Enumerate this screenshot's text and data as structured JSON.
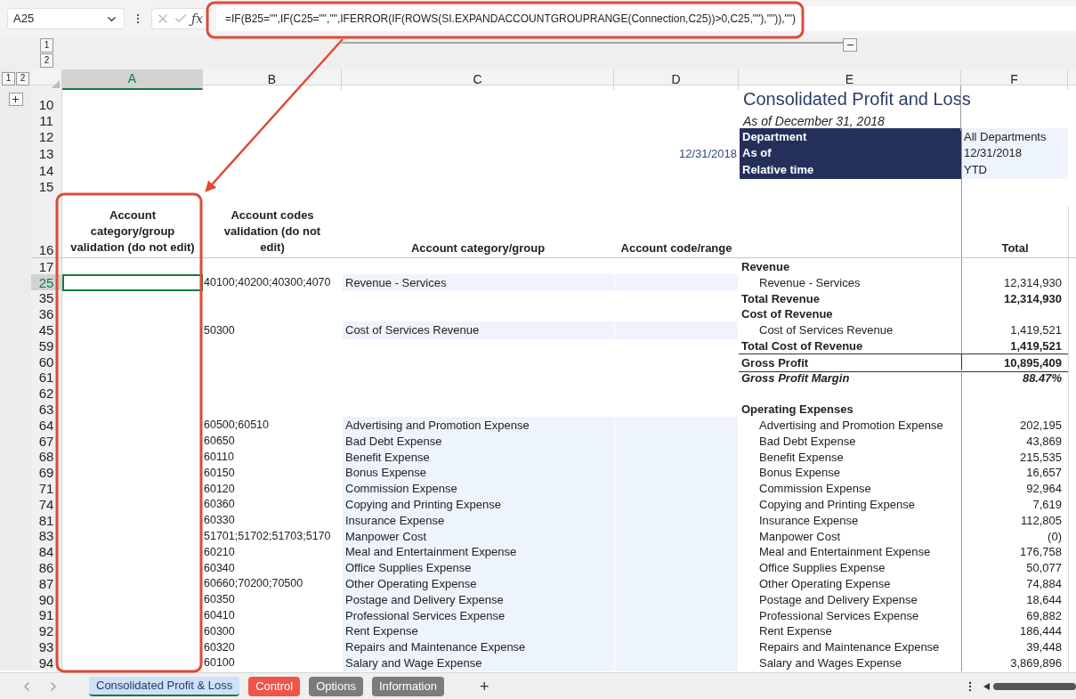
{
  "formula_bar": {
    "name_box": "A25",
    "function_label": "ƒx",
    "formula": "=IF(B25=\"\",IF(C25=\"\",\"\",IFERROR(IF(ROWS(SI.EXPANDACCOUNTGROUPRANGE(Connection,C25))>0,C25,\"\"),\"\")),\"\")"
  },
  "outline": {
    "column_levels": [
      "1",
      "2"
    ],
    "row_levels": [
      "1",
      "2"
    ]
  },
  "columns": [
    {
      "label": "A",
      "selected": true
    },
    {
      "label": "B",
      "selected": false
    },
    {
      "label": "C",
      "selected": false
    },
    {
      "label": "D",
      "selected": false
    },
    {
      "label": "E",
      "selected": false
    },
    {
      "label": "F",
      "selected": false
    }
  ],
  "report": {
    "row_numbers": [
      "10",
      "11",
      "12",
      "13",
      "14",
      "15",
      "16"
    ],
    "title": "Consolidated Profit and Loss",
    "subtitle": "As of December 31, 2018",
    "as_of_date": "12/31/2018",
    "parameters": [
      {
        "label": "Department",
        "value": "All Departments"
      },
      {
        "label": "As of",
        "value": "12/31/2018"
      },
      {
        "label": "Relative time",
        "value": "YTD"
      }
    ],
    "headers": {
      "a": "Account category/group validation (do not edit)",
      "b": "Account codes validation (do not edit)",
      "c": "Account category/group",
      "d": "Account code/range",
      "f": "Total"
    }
  },
  "rows": [
    {
      "row": "17",
      "kind": "heading",
      "label": "Revenue",
      "selected": false
    },
    {
      "row": "25",
      "kind": "item",
      "code": "40100;40200;40300;4070",
      "category": "Revenue - Services",
      "label": "Revenue - Services",
      "total": "12,314,930",
      "selected": true
    },
    {
      "row": "35",
      "kind": "total",
      "label": "Total Revenue",
      "total": "12,314,930",
      "selected": false
    },
    {
      "row": "36",
      "kind": "heading",
      "label": "Cost of Revenue",
      "selected": false
    },
    {
      "row": "45",
      "kind": "item",
      "code": "50300",
      "category": "Cost of Services Revenue",
      "label": "Cost of Services Revenue",
      "total": "1,419,521",
      "selected": false
    },
    {
      "row": "59",
      "kind": "total",
      "label": "Total Cost of Revenue",
      "total": "1,419,521",
      "selected": false
    },
    {
      "row": "60",
      "kind": "gross",
      "label": "Gross Profit",
      "total": "10,895,409",
      "selected": false
    },
    {
      "row": "61",
      "kind": "margin",
      "label": "Gross Profit Margin",
      "total": "88.47%",
      "selected": false
    },
    {
      "row": "62",
      "kind": "blank",
      "selected": false
    },
    {
      "row": "63",
      "kind": "heading",
      "label": "Operating Expenses",
      "selected": false
    },
    {
      "row": "64",
      "kind": "item",
      "code": "60500;60510",
      "category": "Advertising and Promotion Expense",
      "label": "Advertising and Promotion Expense",
      "total": "202,195",
      "selected": false
    },
    {
      "row": "67",
      "kind": "item",
      "code": "60650",
      "category": "Bad Debt Expense",
      "label": "Bad Debt Expense",
      "total": "43,869",
      "selected": false
    },
    {
      "row": "68",
      "kind": "item",
      "code": "60110",
      "category": "Benefit Expense",
      "label": "Benefit Expense",
      "total": "215,535",
      "selected": false
    },
    {
      "row": "69",
      "kind": "item",
      "code": "60150",
      "category": "Bonus Expense",
      "label": "Bonus Expense",
      "total": "16,657",
      "selected": false
    },
    {
      "row": "71",
      "kind": "item",
      "code": "60120",
      "category": "Commission Expense",
      "label": "Commission Expense",
      "total": "92,964",
      "selected": false
    },
    {
      "row": "74",
      "kind": "item",
      "code": "60360",
      "category": "Copying and Printing Expense",
      "label": "Copying and Printing Expense",
      "total": "7,619",
      "selected": false
    },
    {
      "row": "81",
      "kind": "item",
      "code": "60330",
      "category": "Insurance Expense",
      "label": "Insurance Expense",
      "total": "112,805",
      "selected": false
    },
    {
      "row": "83",
      "kind": "item",
      "code": "51701;51702;51703;5170",
      "category": "Manpower Cost",
      "label": "Manpower Cost",
      "total": "(0)",
      "selected": false
    },
    {
      "row": "84",
      "kind": "item",
      "code": "60210",
      "category": "Meal and Entertainment Expense",
      "label": "Meal and Entertainment Expense",
      "total": "176,758",
      "selected": false
    },
    {
      "row": "86",
      "kind": "item",
      "code": "60340",
      "category": "Office Supplies Expense",
      "label": "Office Supplies Expense",
      "total": "50,077",
      "selected": false
    },
    {
      "row": "87",
      "kind": "item",
      "code": "60660;70200;70500",
      "category": "Other Operating Expense",
      "label": "Other Operating Expense",
      "total": "74,884",
      "selected": false
    },
    {
      "row": "90",
      "kind": "item",
      "code": "60350",
      "category": "Postage and Delivery Expense",
      "label": "Postage and Delivery Expense",
      "total": "18,644",
      "selected": false
    },
    {
      "row": "91",
      "kind": "item",
      "code": "60410",
      "category": "Professional Services Expense",
      "label": "Professional Services Expense",
      "total": "69,882",
      "selected": false
    },
    {
      "row": "92",
      "kind": "item",
      "code": "60300",
      "category": "Rent Expense",
      "label": "Rent Expense",
      "total": "186,444",
      "selected": false
    },
    {
      "row": "93",
      "kind": "item",
      "code": "60320",
      "category": "Repairs and Maintenance Expense",
      "label": "Repairs and Maintenance Expense",
      "total": "39,448",
      "selected": false
    },
    {
      "row": "94",
      "kind": "item",
      "code": "60100",
      "category": "Salary and Wage Expense",
      "label": "Salary and Wages Expense",
      "total": "3,869,896",
      "selected": false
    }
  ],
  "sheet_tabs": [
    {
      "label": "Consolidated Profit & Loss",
      "selected": true
    },
    {
      "label": "Control",
      "color": "#f0554a",
      "selected": false
    },
    {
      "label": "Options",
      "color": "#7b7b7b",
      "selected": false
    },
    {
      "label": "Information",
      "color": "#7b7b7b",
      "selected": false
    }
  ],
  "add_sheet": "+"
}
